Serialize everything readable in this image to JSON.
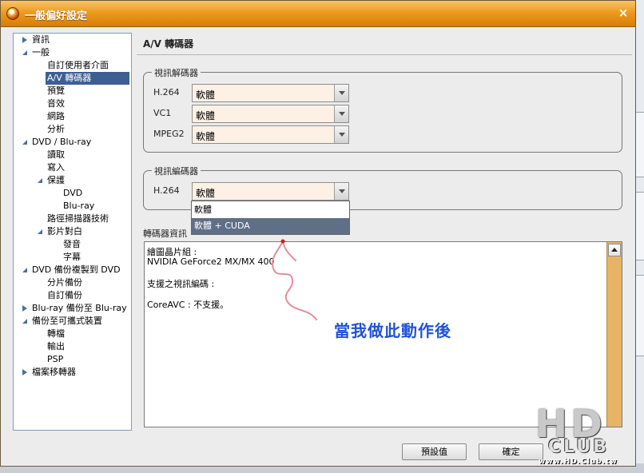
{
  "window": {
    "title": "一般偏好設定",
    "close_glyph": "×"
  },
  "sidebar": {
    "items": [
      {
        "label": "資訊",
        "level": 0,
        "state": "collapsed"
      },
      {
        "label": "一般",
        "level": 0,
        "state": "expanded"
      },
      {
        "label": "自訂使用者介面",
        "level": 1
      },
      {
        "label": "A/V 轉碼器",
        "level": 1,
        "selected": true
      },
      {
        "label": "預覽",
        "level": 1
      },
      {
        "label": "音效",
        "level": 1
      },
      {
        "label": "網路",
        "level": 1
      },
      {
        "label": "分析",
        "level": 1
      },
      {
        "label": "DVD / Blu-ray",
        "level": 0,
        "state": "expanded"
      },
      {
        "label": "讀取",
        "level": 1
      },
      {
        "label": "寫入",
        "level": 1
      },
      {
        "label": "保護",
        "level": 1,
        "state": "expanded"
      },
      {
        "label": "DVD",
        "level": 2
      },
      {
        "label": "Blu-ray",
        "level": 2
      },
      {
        "label": "路徑掃描器技術",
        "level": 1
      },
      {
        "label": "影片對白",
        "level": 1,
        "state": "expanded"
      },
      {
        "label": "發音",
        "level": 2
      },
      {
        "label": "字幕",
        "level": 2
      },
      {
        "label": "DVD 備份複製到 DVD",
        "level": 0,
        "state": "expanded"
      },
      {
        "label": "分片備份",
        "level": 1
      },
      {
        "label": "自訂備份",
        "level": 1
      },
      {
        "label": "Blu-ray 備份至 Blu-ray",
        "level": 0,
        "state": "collapsed"
      },
      {
        "label": "備份至可攜式裝置",
        "level": 0,
        "state": "expanded"
      },
      {
        "label": "轉檔",
        "level": 1
      },
      {
        "label": "輸出",
        "level": 1
      },
      {
        "label": "PSP",
        "level": 1
      },
      {
        "label": "檔案移轉器",
        "level": 0,
        "state": "collapsed"
      }
    ]
  },
  "panel": {
    "title": "A/V 轉碼器",
    "decoder_group": {
      "legend": "視訊解碼器",
      "rows": [
        {
          "label": "H.264",
          "value": "軟體"
        },
        {
          "label": "VC1",
          "value": "軟體"
        },
        {
          "label": "MPEG2",
          "value": "軟體"
        }
      ]
    },
    "encoder_group": {
      "legend": "視訊編碼器",
      "rows": [
        {
          "label": "H.264",
          "value": "軟體"
        }
      ]
    },
    "dropdown": {
      "options": [
        "軟體",
        "軟體 + CUDA"
      ],
      "highlighted": 1
    },
    "info": {
      "label": "轉碼器資訊",
      "lines": [
        "繪圖晶片組 :",
        "NVIDIA GeForce2 MX/MX 400",
        "",
        "支援之視訊編碼 :",
        "",
        "CoreAVC : 不支援。"
      ]
    }
  },
  "buttons": {
    "default_label": "預設值",
    "ok_label": "確定"
  },
  "annotation": {
    "text": "當我做此動作後",
    "color": "#1f52d6"
  },
  "watermark": {
    "hd": "HD",
    "club": "CLUB",
    "url": "www.HD.Club.tw"
  },
  "colors": {
    "titlebar": "#ec9b1f",
    "selection": "#3d5f92",
    "scrollbar": "#e7b466",
    "combo_bg": "#fdf1e6"
  }
}
